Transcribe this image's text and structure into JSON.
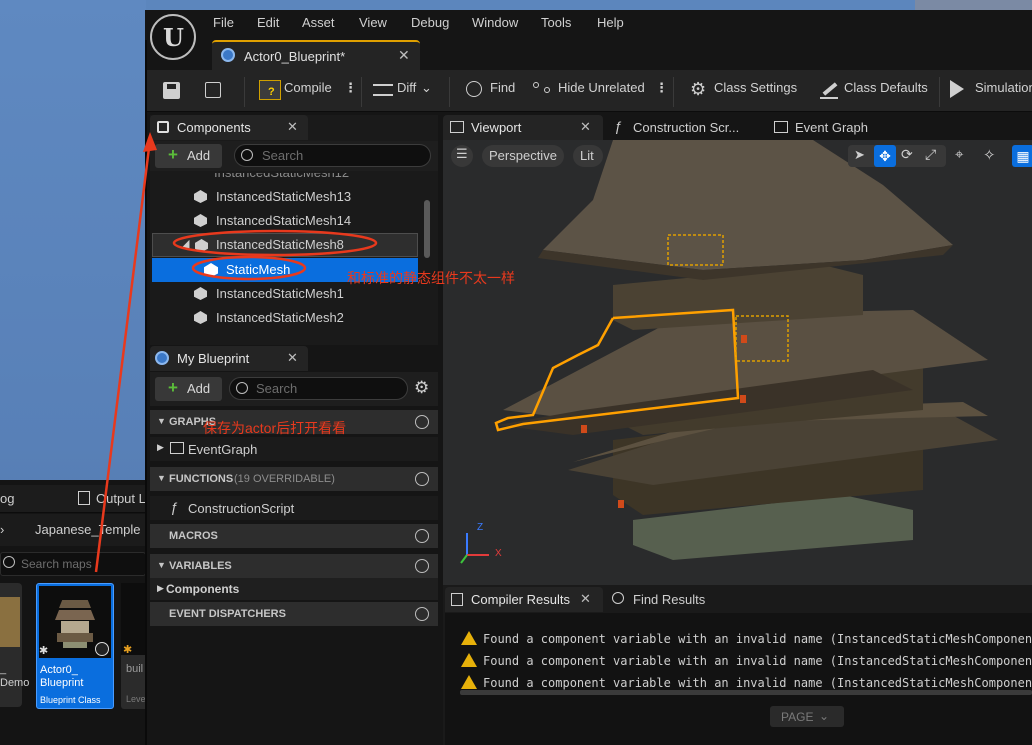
{
  "background": {
    "partial_tabs": [
      "og",
      "Output L"
    ],
    "path_items": [
      "Japanese_Temple"
    ],
    "search_placeholder": "Search maps",
    "assets": [
      {
        "line1": "_",
        "line2": "Demo"
      },
      {
        "line1": "Actor0_",
        "line2": "Blueprint",
        "type": "Blueprint Class"
      },
      {
        "line1": "buil",
        "line2": "",
        "type": "Leve"
      }
    ]
  },
  "menu": [
    "File",
    "Edit",
    "Asset",
    "View",
    "Debug",
    "Window",
    "Tools",
    "Help"
  ],
  "document_tab": {
    "title": "Actor0_Blueprint*"
  },
  "toolbar": {
    "compile": "Compile",
    "diff": "Diff",
    "find": "Find",
    "hide_unrelated": "Hide Unrelated",
    "class_settings": "Class Settings",
    "class_defaults": "Class Defaults",
    "simulation": "Simulation"
  },
  "components_panel": {
    "title": "Components",
    "add": "Add",
    "search_placeholder": "Search",
    "items": [
      "InstancedStaticMesh13",
      "InstancedStaticMesh14",
      "InstancedStaticMesh8",
      "StaticMesh",
      "InstancedStaticMesh1",
      "InstancedStaticMesh2"
    ]
  },
  "my_blueprint": {
    "title": "My Blueprint",
    "add": "Add",
    "search_placeholder": "Search",
    "graphs_label": "GRAPHS",
    "event_graph": "EventGraph",
    "functions_label": "FUNCTIONS",
    "functions_count": "(19 OVERRIDABLE)",
    "construction_script": "ConstructionScript",
    "macros_label": "MACROS",
    "variables_label": "VARIABLES",
    "components_label": "Components",
    "event_dispatchers_label": "EVENT DISPATCHERS"
  },
  "editor_tabs": {
    "viewport": "Viewport",
    "construction": "Construction Scr...",
    "event_graph": "Event Graph"
  },
  "viewport": {
    "perspective": "Perspective",
    "lit": "Lit",
    "axis_x": "X",
    "axis_z": "Z"
  },
  "bottom_tabs": {
    "compiler_results": "Compiler Results",
    "find_results": "Find Results"
  },
  "compiler_messages": [
    "Found a component variable with an invalid name (InstancedStaticMeshComponent_",
    "Found a component variable with an invalid name (InstancedStaticMeshComponent_",
    "Found a component variable with an invalid name (InstancedStaticMeshComponent_"
  ],
  "page_button": "PAGE",
  "annotations": {
    "note1": "和标准的静态组件不太一样",
    "note2": "保存为actor后打开看看"
  },
  "colors": {
    "accent_blue": "#0a6ede",
    "selection_orange": "#ffa000",
    "annotation_red": "#e8391d",
    "warning_yellow": "#e7b10a"
  }
}
